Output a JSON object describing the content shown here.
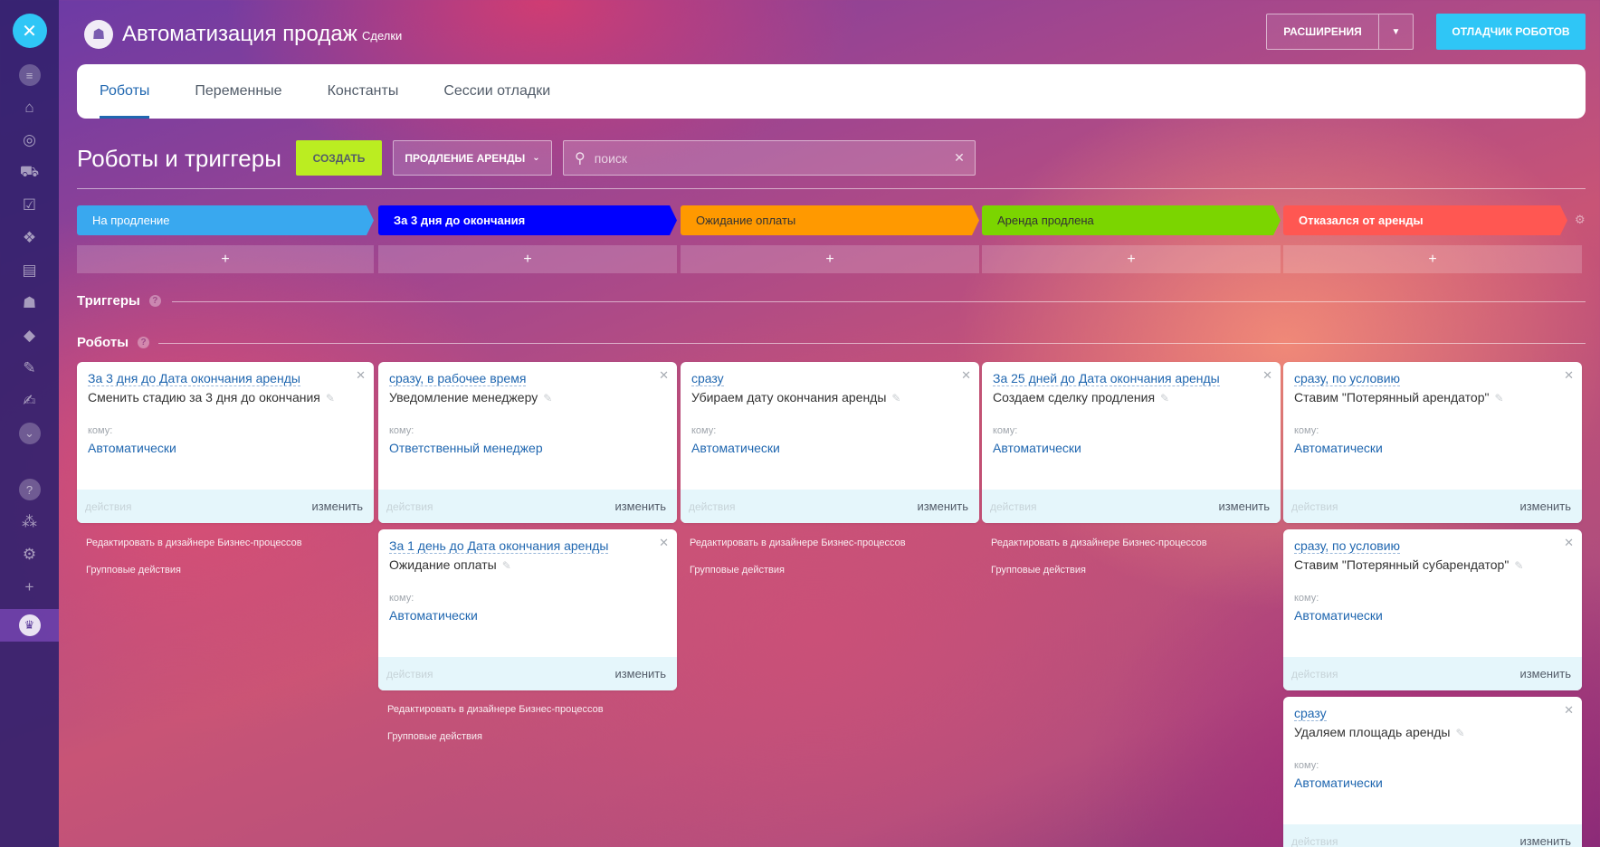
{
  "header": {
    "title": "Автоматизация продаж",
    "subtitle": "Сделки",
    "extensions_label": "РАСШИРЕНИЯ",
    "debugger_label": "ОТЛАДЧИК РОБОТОВ"
  },
  "tabs": [
    "Роботы",
    "Переменные",
    "Константы",
    "Сессии отладки"
  ],
  "toolbar": {
    "section_title": "Роботы и триггеры",
    "create_label": "СОЗДАТЬ",
    "filter_label": "ПРОДЛЕНИЕ АРЕНДЫ",
    "search_placeholder": "поиск"
  },
  "stages": [
    {
      "label": "На продление",
      "color": "#39a8ef"
    },
    {
      "label": "За 3 дня до окончания",
      "color": "#0000ff"
    },
    {
      "label": "Ожидание оплаты",
      "color": "#ff9900"
    },
    {
      "label": "Аренда продлена",
      "color": "#7bd500"
    },
    {
      "label": "Отказался от аренды",
      "color": "#ff5752"
    }
  ],
  "add_symbol": "+",
  "triggers_title": "Триггеры",
  "robots_title": "Роботы",
  "common": {
    "to_label": "кому:",
    "actions_label": "действия",
    "edit_label": "изменить",
    "designer_link": "Редактировать в дизайнере Бизнес-процессов",
    "group_link": "Групповые действия"
  },
  "robots": [
    {
      "when": "За 3 дня до Дата окончания аренды",
      "name": "Сменить стадию за 3 дня до окончания",
      "to": "Автоматически"
    },
    {
      "when": "сразу, в рабочее время",
      "name": "Уведомление менеджеру",
      "to": "Ответственный менеджер"
    },
    {
      "when": "За 1 день до Дата окончания аренды",
      "name": "Ожидание оплаты",
      "to": "Автоматически"
    },
    {
      "when": "сразу",
      "name": "Убираем дату окончания аренды",
      "to": "Автоматически"
    },
    {
      "when": "За 25 дней до Дата окончания аренды",
      "name": "Создаем сделку продления",
      "to": "Автоматически"
    },
    {
      "when": "сразу, по условию",
      "name": "Ставим \"Потерянный арендатор\"",
      "to": "Автоматически"
    },
    {
      "when": "сразу, по условию",
      "name": "Ставим \"Потерянный субарендатор\"",
      "to": "Автоматически"
    },
    {
      "when": "сразу",
      "name": "Удаляем площадь аренды",
      "to": "Автоматически"
    }
  ]
}
